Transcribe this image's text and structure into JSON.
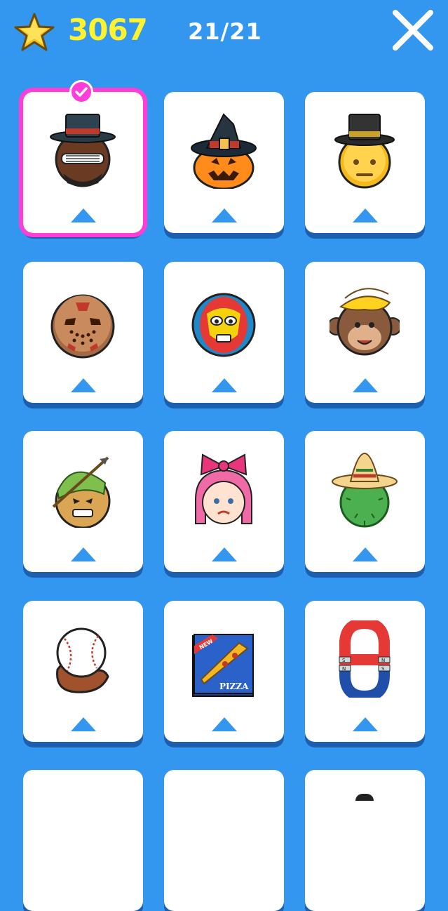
{
  "header": {
    "score": "3067",
    "progress": "21/21",
    "score_icon": "star-icon",
    "close_icon": "close-icon"
  },
  "colors": {
    "background": "#3396ef",
    "score": "#fff22e",
    "selected_outline": "#ff3dd8",
    "card_shadow": "#1c5fae",
    "triangle": "#3396ef"
  },
  "items": [
    {
      "name": "sunglasses-top-hat-face",
      "selected": true
    },
    {
      "name": "witch-hat-pumpkin"
    },
    {
      "name": "top-hat-neutral-face"
    },
    {
      "name": "hockey-mask-face"
    },
    {
      "name": "luchador-mask-face"
    },
    {
      "name": "banana-monkey-face"
    },
    {
      "name": "robin-hood-angry-face"
    },
    {
      "name": "pink-bow-girl-face"
    },
    {
      "name": "sombrero-cactus"
    },
    {
      "name": "baseball-glove"
    },
    {
      "name": "pizza-box"
    },
    {
      "name": "horseshoe-magnet"
    },
    {
      "name": "partial-card-1"
    },
    {
      "name": "partial-card-2"
    },
    {
      "name": "partial-card-3"
    }
  ],
  "pizza_box": {
    "badge": "NEW",
    "label": "PIZZA"
  },
  "magnet": {
    "n": "N",
    "s": "S"
  }
}
